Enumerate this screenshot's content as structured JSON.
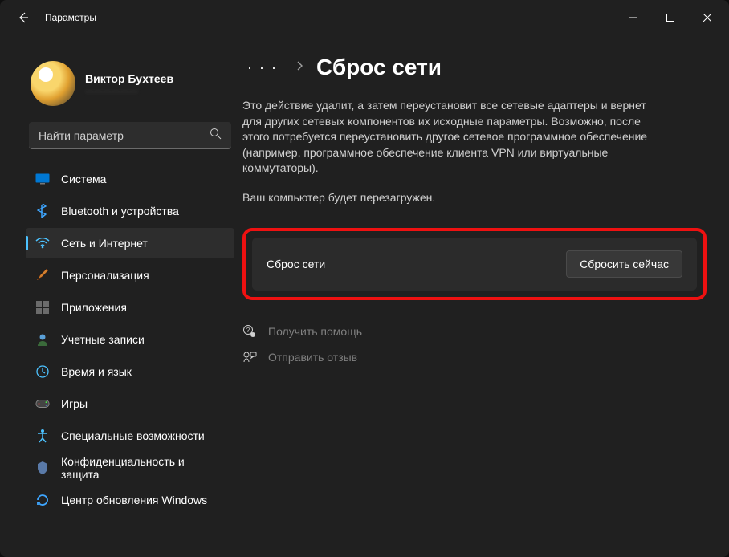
{
  "titlebar": {
    "title": "Параметры"
  },
  "profile": {
    "name": "Виктор Бухтеев",
    "email": "………………"
  },
  "search": {
    "placeholder": "Найти параметр"
  },
  "sidebar": {
    "items": [
      {
        "label": "Система",
        "icon": "system"
      },
      {
        "label": "Bluetooth и устройства",
        "icon": "bluetooth"
      },
      {
        "label": "Сеть и Интернет",
        "icon": "wifi",
        "active": true
      },
      {
        "label": "Персонализация",
        "icon": "brush"
      },
      {
        "label": "Приложения",
        "icon": "apps"
      },
      {
        "label": "Учетные записи",
        "icon": "account"
      },
      {
        "label": "Время и язык",
        "icon": "time"
      },
      {
        "label": "Игры",
        "icon": "games"
      },
      {
        "label": "Специальные возможности",
        "icon": "accessibility"
      },
      {
        "label": "Конфиденциальность и защита",
        "icon": "privacy"
      },
      {
        "label": "Центр обновления Windows",
        "icon": "update"
      }
    ]
  },
  "main": {
    "ellipsis": "· · ·",
    "title": "Сброс сети",
    "description": "Это действие удалит, а затем переустановит все сетевые адаптеры и вернет для других сетевых компонентов их исходные параметры. Возможно, после этого потребуется переустановить другое сетевое программное обеспечение (например, программное обеспечение клиента VPN или виртуальные коммутаторы).",
    "note": "Ваш компьютер будет перезагружен.",
    "card": {
      "label": "Сброс сети",
      "button": "Сбросить сейчас"
    },
    "links": {
      "help": "Получить помощь",
      "feedback": "Отправить отзыв"
    }
  }
}
